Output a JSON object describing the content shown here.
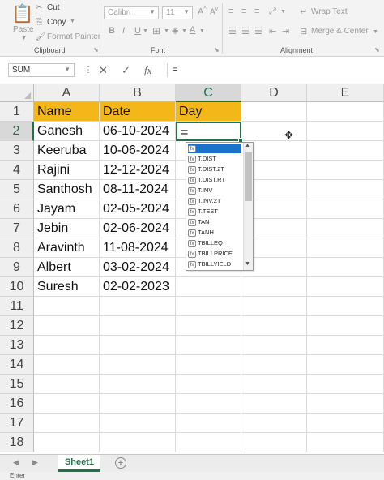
{
  "ribbon": {
    "clipboard": {
      "paste": "Paste",
      "cut": "Cut",
      "copy": "Copy",
      "format_painter": "Format Painter",
      "label": "Clipboard"
    },
    "font": {
      "font_name": "Calibri",
      "font_size": "11",
      "bold": "B",
      "italic": "I",
      "underline": "U",
      "label": "Font"
    },
    "alignment": {
      "wrap_text": "Wrap Text",
      "merge_center": "Merge & Center",
      "label": "Alignment"
    }
  },
  "formula_bar": {
    "name_box": "SUM",
    "cancel_icon": "✕",
    "enter_icon": "✓",
    "fx_icon": "fx",
    "formula": "="
  },
  "columns": [
    "A",
    "B",
    "C",
    "D",
    "E"
  ],
  "rows": [
    "1",
    "2",
    "3",
    "4",
    "5",
    "6",
    "7",
    "8",
    "9",
    "10",
    "11",
    "12",
    "13",
    "14",
    "15",
    "16",
    "17",
    "18"
  ],
  "table": {
    "headers": [
      "Name",
      "Date",
      "Day"
    ],
    "rows": [
      [
        "Ganesh",
        "06-10-2024",
        "="
      ],
      [
        "Keeruba",
        "10-06-2024",
        ""
      ],
      [
        "Rajini",
        "12-12-2024",
        ""
      ],
      [
        "Santhosh",
        "08-11-2024",
        ""
      ],
      [
        "Jayam",
        "02-05-2024",
        ""
      ],
      [
        "Jebin",
        "02-06-2024",
        ""
      ],
      [
        "Aravinth",
        "11-08-2024",
        ""
      ],
      [
        "Albert",
        "03-02-2024",
        ""
      ],
      [
        "Suresh",
        "02-02-2023",
        ""
      ]
    ]
  },
  "autocomplete": {
    "items": [
      "",
      "T.DIST",
      "T.DIST.2T",
      "T.DIST.RT",
      "T.INV",
      "T.INV.2T",
      "T.TEST",
      "TAN",
      "TANH",
      "TBILLEQ",
      "TBILLPRICE",
      "TBILLYIELD"
    ],
    "scroll_up": "▲",
    "scroll_down": "▼"
  },
  "sheet_tabs": {
    "active": "Sheet1",
    "add": "+"
  },
  "status": {
    "mode": "Enter"
  },
  "colors": {
    "header_fill": "#f3b71a",
    "accent": "#217346",
    "highlight": "#1a73c8"
  }
}
